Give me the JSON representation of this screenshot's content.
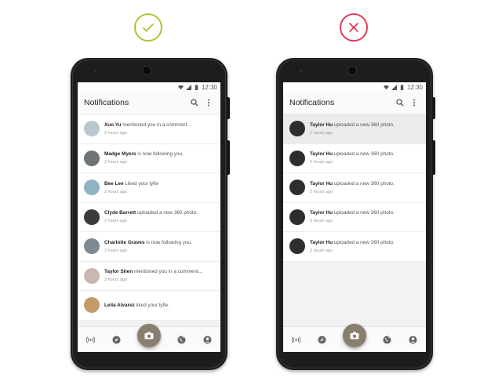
{
  "colors": {
    "good": "#a3c936",
    "bad": "#e23a58",
    "fab": "#8a7e6e",
    "highlight_row": "#ebebeb"
  },
  "verdicts": {
    "good": {
      "icon": "check-icon"
    },
    "bad": {
      "icon": "cross-icon"
    }
  },
  "phones": {
    "left": {
      "status_time": "12:30",
      "app_title": "Notifications",
      "notifications": [
        {
          "name": "Xun Yu",
          "action": " mentioned you in a comment...",
          "time": "2 hours ago",
          "avatar_color": "#b9c7cf"
        },
        {
          "name": "Madge Myers",
          "action": " is now following you.",
          "time": "2 hours ago",
          "avatar_color": "#6f7477"
        },
        {
          "name": "Bee Lee",
          "action": " Liked your lyfie",
          "time": "2 hours ago",
          "avatar_color": "#8fb2c4"
        },
        {
          "name": "Clyde Barrett",
          "action": " uploaded a new 360 photo.",
          "time": "2 hours ago",
          "avatar_color": "#3a3a3a"
        },
        {
          "name": "Charlotte Graves",
          "action": " is now following you.",
          "time": "2 hours ago",
          "avatar_color": "#7d8a93"
        },
        {
          "name": "Taylor Shen",
          "action": " mentioned you in a comment...",
          "time": "2 hours ago",
          "avatar_color": "#c9b8b2"
        },
        {
          "name": "Leila Alvarez",
          "action": " liked your lyfie.",
          "time": "",
          "avatar_color": "#c59a6a"
        }
      ]
    },
    "right": {
      "status_time": "12:30",
      "app_title": "Notifications",
      "notifications": [
        {
          "name": "Taylor Hu",
          "action": " uploaded a new 360 photo.",
          "time": "2 hours ago",
          "avatar_color": "#2e2e2e"
        },
        {
          "name": "Taylor Hu",
          "action": " uploaded a new 360 photo.",
          "time": "2 hours ago",
          "avatar_color": "#2e2e2e"
        },
        {
          "name": "Taylor Hu",
          "action": " uploaded a new 360 photo.",
          "time": "2 hours ago",
          "avatar_color": "#2e2e2e"
        },
        {
          "name": "Taylor Hu",
          "action": " uploaded a new 360 photo.",
          "time": "2 hours ago",
          "avatar_color": "#2e2e2e"
        },
        {
          "name": "Taylor Hu",
          "action": " uploaded a new 360 photo.",
          "time": "2 hours ago",
          "avatar_color": "#2e2e2e"
        }
      ]
    }
  },
  "bottom_nav": [
    "live-icon",
    "compass-icon",
    "camera-icon",
    "globe-icon",
    "profile-icon"
  ]
}
